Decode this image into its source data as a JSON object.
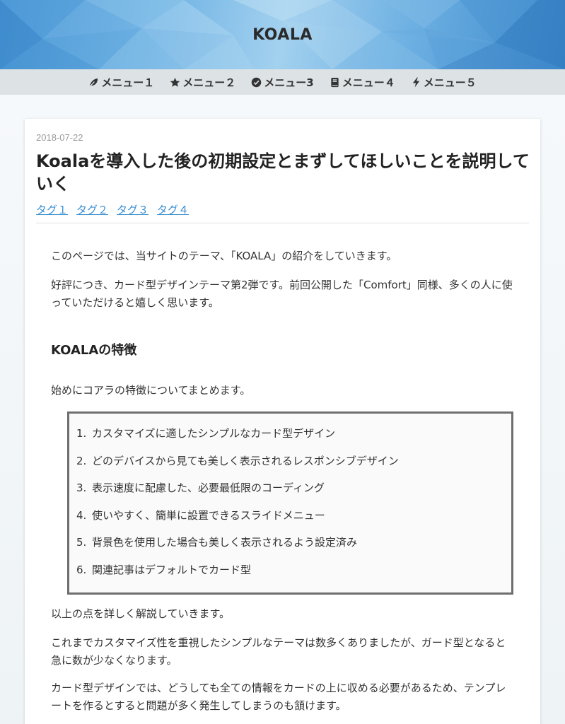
{
  "site": {
    "title": "KOALA"
  },
  "nav": [
    {
      "label": "メニュー１",
      "icon": "leaf-icon"
    },
    {
      "label": "メニュー２",
      "icon": "star-icon"
    },
    {
      "label": "メニュー3",
      "icon": "check-circle-icon"
    },
    {
      "label": "メニュー４",
      "icon": "book-icon"
    },
    {
      "label": "メニュー５",
      "icon": "bolt-icon"
    }
  ],
  "post": {
    "date": "2018-07-22",
    "title": "Koalaを導入した後の初期設定とまずしてほしいことを説明していく",
    "tags": [
      "タグ１",
      "タグ２",
      "タグ３",
      "タグ４"
    ],
    "intro1": "このページでは、当サイトのテーマ、「KOALA」の紹介をしていきます。",
    "intro2": "好評につき、カード型デザインテーマ第2弾です。前回公開した「Comfort」同様、多くの人に使っていただけると嬉しく思います。",
    "heading": "KOALAの特徴",
    "lead": "始めにコアラの特徴についてまとめます。",
    "features": [
      "カスタマイズに適したシンプルなカード型デザイン",
      "どのデバイスから見ても美しく表示されるレスポンシブデザイン",
      "表示速度に配慮した、必要最低限のコーディング",
      "使いやすく、簡単に設置できるスライドメニュー",
      "背景色を使用した場合も美しく表示されるよう設定済み",
      "関連記事はデフォルトでカード型"
    ],
    "after1": "以上の点を詳しく解説していきます。",
    "after2": "これまでカスタマイズ性を重視したシンプルなテーマは数多くありましたが、ガード型となると急に数が少なくなります。",
    "after3": "カード型デザインでは、どうしても全ての情報をカードの上に収める必要があるため、テンプレートを作るとすると問題が多く発生してしまうのも頷けます。"
  },
  "colors": {
    "header_blue": "#4a97d6",
    "nav_bg": "#dde2e5",
    "link": "#3b8fd0",
    "list_border": "#6e6e6e"
  }
}
